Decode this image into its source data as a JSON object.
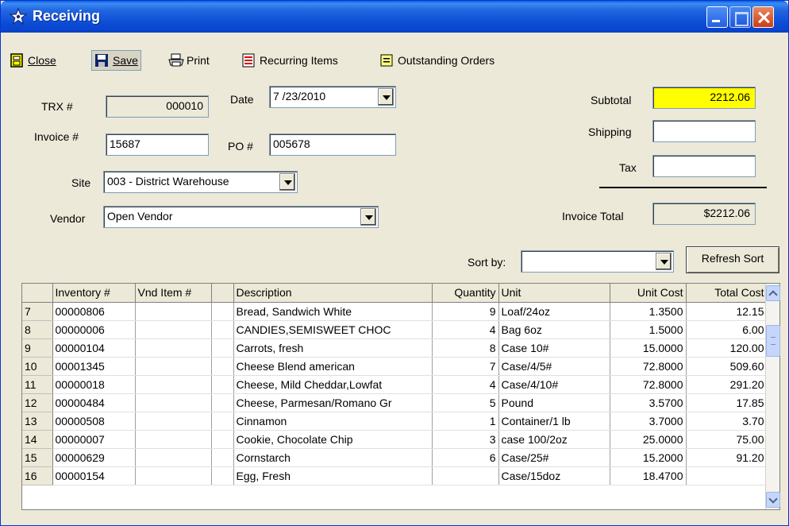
{
  "window": {
    "title": "Receiving"
  },
  "toolbar": {
    "close_label": "Close",
    "save_label": "Save",
    "print_label": "Print",
    "recurring_label": "Recurring Items",
    "outstanding_label": "Outstanding Orders"
  },
  "form": {
    "trx_label": "TRX #",
    "trx_value": "000010",
    "date_label": "Date",
    "date_value": "7 /23/2010",
    "invoice_label": "Invoice #",
    "invoice_value": "15687",
    "po_label": "PO #",
    "po_value": "005678",
    "site_label": "Site",
    "site_value": "003 - District Warehouse",
    "vendor_label": "Vendor",
    "vendor_value": "Open Vendor"
  },
  "totals": {
    "subtotal_label": "Subtotal",
    "subtotal_value": "2212.06",
    "shipping_label": "Shipping",
    "shipping_value": "",
    "tax_label": "Tax",
    "tax_value": "",
    "invoice_total_label": "Invoice Total",
    "invoice_total_value": "$2212.06"
  },
  "sort": {
    "label": "Sort by:",
    "value": "",
    "refresh_label": "Refresh Sort"
  },
  "grid": {
    "headers": {
      "inventory": "Inventory #",
      "vnd_item": "Vnd Item #",
      "description": "Description",
      "quantity": "Quantity",
      "unit": "Unit",
      "unit_cost": "Unit Cost",
      "total_cost": "Total Cost"
    },
    "rows": [
      {
        "num": "7",
        "inventory": "00000806",
        "vnd_item": "",
        "description": "Bread, Sandwich White",
        "quantity": "9",
        "unit": "Loaf/24oz",
        "unit_cost": "1.3500",
        "total_cost": "12.15"
      },
      {
        "num": "8",
        "inventory": "00000006",
        "vnd_item": "",
        "description": "CANDIES,SEMISWEET CHOC",
        "quantity": "4",
        "unit": "Bag 6oz",
        "unit_cost": "1.5000",
        "total_cost": "6.00"
      },
      {
        "num": "9",
        "inventory": "00000104",
        "vnd_item": "",
        "description": "Carrots, fresh",
        "quantity": "8",
        "unit": "Case 10#",
        "unit_cost": "15.0000",
        "total_cost": "120.00"
      },
      {
        "num": "10",
        "inventory": "00001345",
        "vnd_item": "",
        "description": "Cheese Blend american",
        "quantity": "7",
        "unit": "Case/4/5#",
        "unit_cost": "72.8000",
        "total_cost": "509.60"
      },
      {
        "num": "11",
        "inventory": "00000018",
        "vnd_item": "",
        "description": "Cheese, Mild Cheddar,Lowfat",
        "quantity": "4",
        "unit": "Case/4/10#",
        "unit_cost": "72.8000",
        "total_cost": "291.20"
      },
      {
        "num": "12",
        "inventory": "00000484",
        "vnd_item": "",
        "description": "Cheese, Parmesan/Romano Gr",
        "quantity": "5",
        "unit": "Pound",
        "unit_cost": "3.5700",
        "total_cost": "17.85"
      },
      {
        "num": "13",
        "inventory": "00000508",
        "vnd_item": "",
        "description": "Cinnamon",
        "quantity": "1",
        "unit": "Container/1 lb",
        "unit_cost": "3.7000",
        "total_cost": "3.70"
      },
      {
        "num": "14",
        "inventory": "00000007",
        "vnd_item": "",
        "description": "Cookie, Chocolate Chip",
        "quantity": "3",
        "unit": "case 100/2oz",
        "unit_cost": "25.0000",
        "total_cost": "75.00"
      },
      {
        "num": "15",
        "inventory": "00000629",
        "vnd_item": "",
        "description": "Cornstarch",
        "quantity": "6",
        "unit": "Case/25#",
        "unit_cost": "15.2000",
        "total_cost": "91.20"
      },
      {
        "num": "16",
        "inventory": "00000154",
        "vnd_item": "",
        "description": "Egg, Fresh",
        "quantity": "",
        "unit": "Case/15doz",
        "unit_cost": "18.4700",
        "total_cost": ""
      }
    ]
  },
  "colors": {
    "window_bg": "#ece9d8",
    "title_bar": "#0b4dd6",
    "subtotal_highlight": "#ffff00"
  },
  "icons": {
    "title": "star-icon",
    "close": "door-icon",
    "save": "floppy-disk-icon",
    "print": "printer-icon",
    "recurring": "list-icon",
    "outstanding": "note-icon"
  }
}
